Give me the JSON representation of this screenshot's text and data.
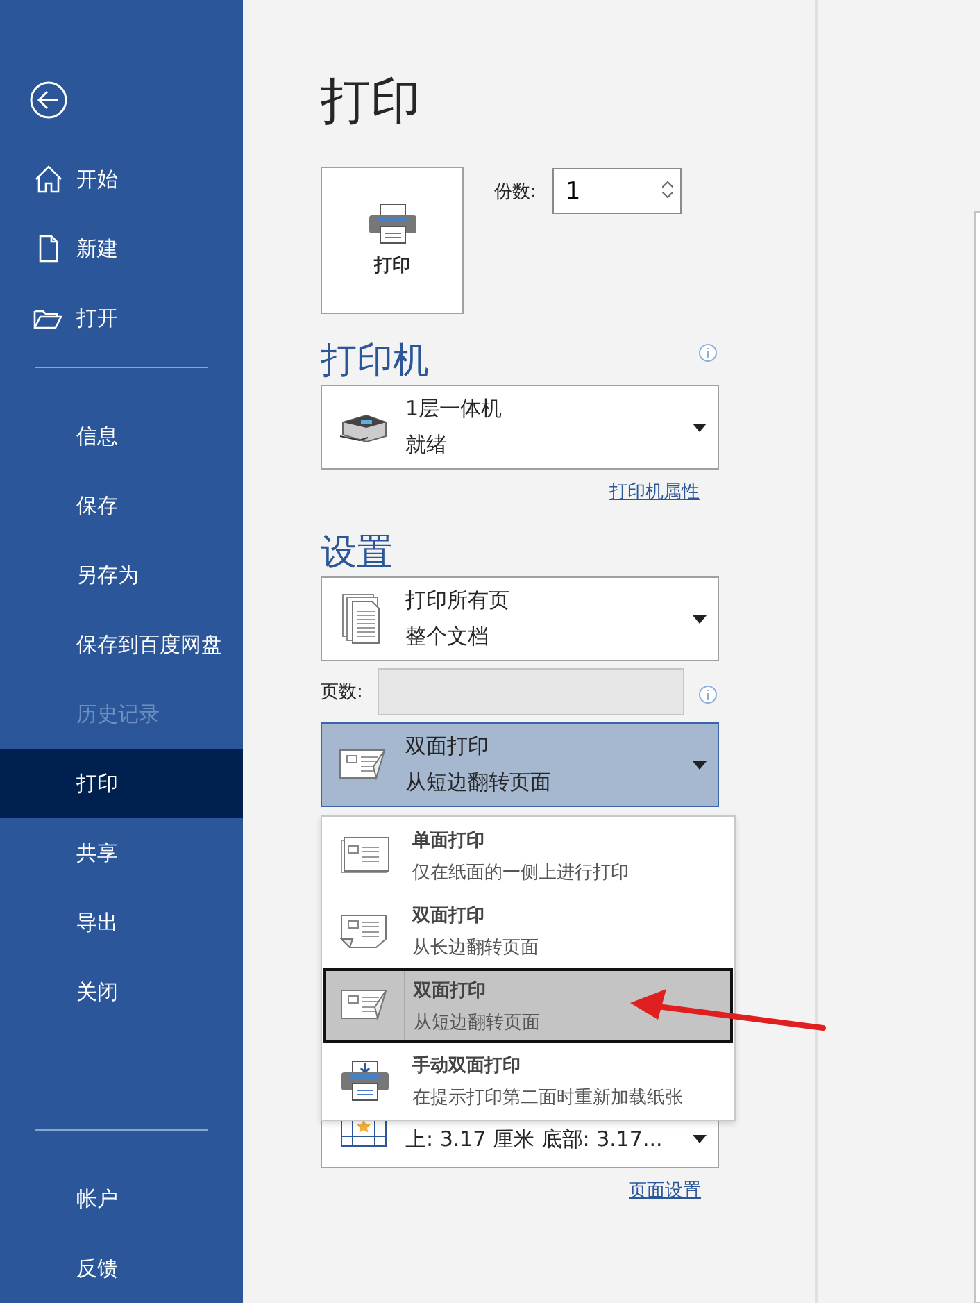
{
  "sidebar": {
    "groups": [
      [
        {
          "label": "开始",
          "selected": false,
          "disabled": false
        },
        {
          "label": "新建",
          "selected": false,
          "disabled": false
        },
        {
          "label": "打开",
          "selected": false,
          "disabled": false
        }
      ],
      [
        {
          "label": "信息",
          "selected": false,
          "disabled": false
        },
        {
          "label": "保存",
          "selected": false,
          "disabled": false
        },
        {
          "label": "另存为",
          "selected": false,
          "disabled": false
        },
        {
          "label": "保存到百度网盘",
          "selected": false,
          "disabled": false
        },
        {
          "label": "历史记录",
          "selected": false,
          "disabled": true
        },
        {
          "label": "打印",
          "selected": true,
          "disabled": false
        },
        {
          "label": "共享",
          "selected": false,
          "disabled": false
        },
        {
          "label": "导出",
          "selected": false,
          "disabled": false
        },
        {
          "label": "关闭",
          "selected": false,
          "disabled": false
        }
      ],
      [
        {
          "label": "帐户",
          "selected": false,
          "disabled": false
        },
        {
          "label": "反馈",
          "selected": false,
          "disabled": false
        }
      ]
    ]
  },
  "title": "打印",
  "print_button": {
    "label": "打印"
  },
  "copies": {
    "label": "份数:",
    "value": "1"
  },
  "printer": {
    "heading": "打印机",
    "name": "1层一体机",
    "status": "就绪",
    "link": "打印机属性"
  },
  "settings": {
    "heading": "设置",
    "pages_dropdown": {
      "line1": "打印所有页",
      "line2": "整个文档"
    },
    "pages": {
      "label": "页数:"
    },
    "duplex": {
      "line1": "双面打印",
      "line2": "从短边翻转页面",
      "open": true
    },
    "duplex_menu": [
      {
        "title": "单面打印",
        "description": "仅在纸面的一侧上进行打印",
        "selected": false
      },
      {
        "title": "双面打印",
        "description": "从长边翻转页面",
        "selected": false
      },
      {
        "title": "双面打印",
        "description": "从短边翻转页面",
        "selected": true
      },
      {
        "title": "手动双面打印",
        "description": "在提示打印第二面时重新加载纸张",
        "selected": false
      }
    ],
    "margins": {
      "line2": "上: 3.17 厘米 底部: 3.17..."
    },
    "link": "页面设置"
  }
}
